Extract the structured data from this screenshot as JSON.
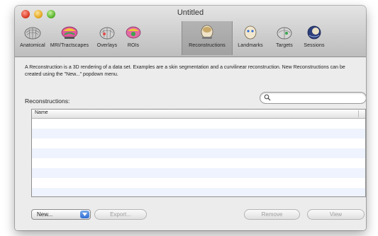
{
  "window": {
    "title": "Untitled"
  },
  "toolbar": {
    "items": [
      {
        "label": "Anatomical",
        "icon": "brain-mesh-icon"
      },
      {
        "label": "MRI/Tractscapes",
        "icon": "colored-brain-icon"
      },
      {
        "label": "Overlays",
        "icon": "overlays-icon"
      },
      {
        "label": "ROIs",
        "icon": "rois-icon"
      },
      {
        "label": "Reconstructions",
        "icon": "reconstruction-head-icon"
      },
      {
        "label": "Landmarks",
        "icon": "landmark-head-icon"
      },
      {
        "label": "Targets",
        "icon": "targets-icon"
      },
      {
        "label": "Sessions",
        "icon": "sessions-icon"
      }
    ],
    "selected": "Reconstructions"
  },
  "main": {
    "description": "A Reconstruction is a 3D rendering of a data set. Examples are a skin segmentation and a curvilinear reconstruction. New Reconstructions can be created using the \"New...\" popdown menu.",
    "section_label": "Reconstructions:",
    "search": {
      "value": "",
      "placeholder": ""
    },
    "table": {
      "columns": [
        "Name"
      ],
      "rows": []
    }
  },
  "buttons": {
    "new": "New...",
    "export": "Export...",
    "remove": "Remove",
    "view": "View"
  },
  "colors": {
    "selection_row": "#eef3fd",
    "popup_arrow": "#2f6ed6"
  }
}
